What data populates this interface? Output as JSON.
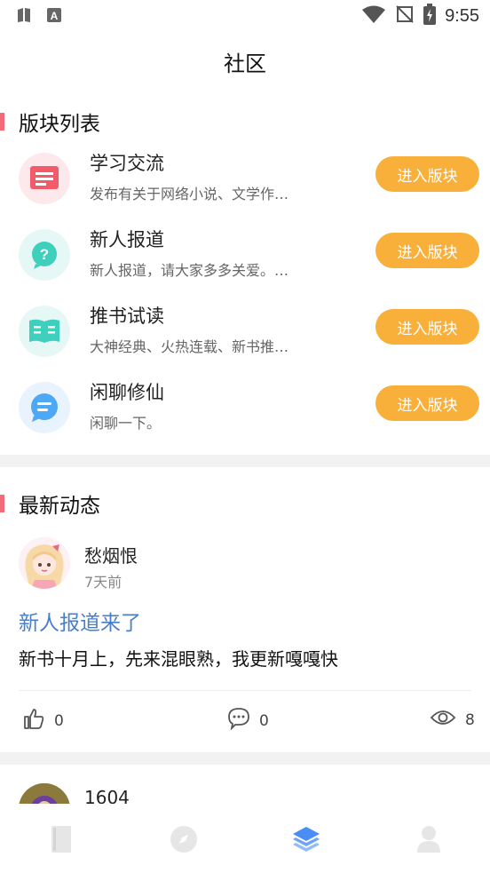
{
  "status_bar": {
    "time": "9:55",
    "icons": [
      "sim-icon",
      "notification-a-icon",
      "wifi-icon",
      "no-signal-icon",
      "battery-charging-icon"
    ]
  },
  "header": {
    "title": "社区"
  },
  "boards_section": {
    "title": "版块列表",
    "items": [
      {
        "name": "学习交流",
        "desc": "发布有关于网络小说、文学作…",
        "button": "进入版块",
        "icon": "note-icon",
        "color": "#f25c6a",
        "bg": "#fde9ec"
      },
      {
        "name": "新人报道",
        "desc": "新人报道，请大家多多关爱。…",
        "button": "进入版块",
        "icon": "question-icon",
        "color": "#3ecfbd",
        "bg": "#e6f8f5"
      },
      {
        "name": "推书试读",
        "desc": "大神经典、火热连载、新书推…",
        "button": "进入版块",
        "icon": "book-icon",
        "color": "#3ecfbd",
        "bg": "#e6f8f5"
      },
      {
        "name": "闲聊修仙",
        "desc": "闲聊一下。",
        "button": "进入版块",
        "icon": "chat-icon",
        "color": "#4da8f5",
        "bg": "#e8f3fd"
      }
    ]
  },
  "feed_section": {
    "title": "最新动态",
    "posts": [
      {
        "user": "愁烟恨",
        "time": "7天前",
        "title": "新人报道来了",
        "body": "新书十月上，先来混眼熟，我更新嘎嘎快",
        "likes": "0",
        "comments": "0",
        "views": "8"
      },
      {
        "user": "1604"
      }
    ]
  },
  "bottom_nav": {
    "items": [
      "bookshelf-icon",
      "discover-icon",
      "community-icon",
      "profile-icon"
    ],
    "active": 2,
    "active_color": "#4a8ef5",
    "inactive_color": "#e6e6e6"
  }
}
